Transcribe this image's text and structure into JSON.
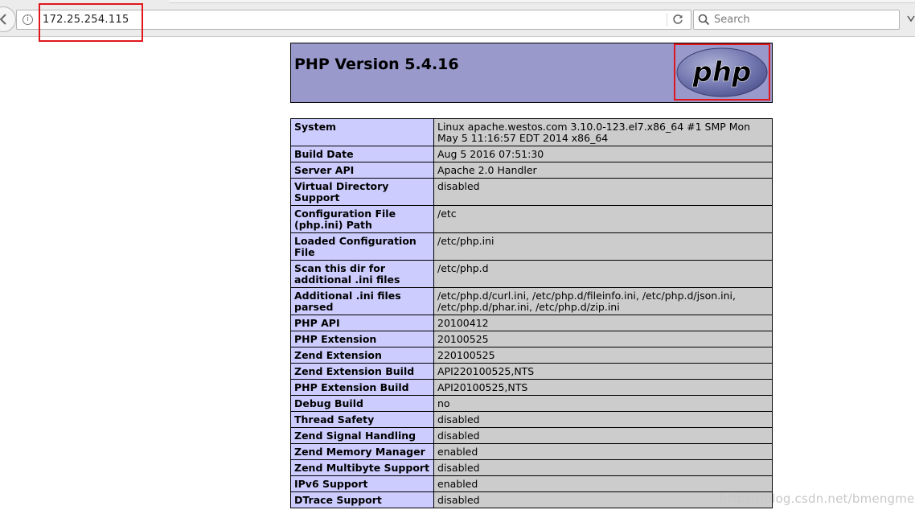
{
  "browser": {
    "url": "172.25.254.115",
    "search_placeholder": "Search",
    "icons": {
      "back": "back-arrow-icon",
      "info": "info-icon",
      "reload": "reload-icon",
      "search": "search-icon"
    }
  },
  "phpinfo": {
    "title": "PHP Version 5.4.16",
    "logo_text": "php",
    "colors": {
      "header_bg": "#9999cc",
      "key_bg": "#ccccff",
      "value_bg": "#cccccc",
      "highlight": "#e0161b"
    },
    "rows": [
      {
        "key": "System",
        "value": "Linux apache.westos.com 3.10.0-123.el7.x86_64 #1 SMP Mon May 5 11:16:57 EDT 2014 x86_64"
      },
      {
        "key": "Build Date",
        "value": "Aug 5 2016 07:51:30"
      },
      {
        "key": "Server API",
        "value": "Apache 2.0 Handler"
      },
      {
        "key": "Virtual Directory Support",
        "value": "disabled"
      },
      {
        "key": "Configuration File (php.ini) Path",
        "value": "/etc"
      },
      {
        "key": "Loaded Configuration File",
        "value": "/etc/php.ini"
      },
      {
        "key": "Scan this dir for additional .ini files",
        "value": "/etc/php.d"
      },
      {
        "key": "Additional .ini files parsed",
        "value": "/etc/php.d/curl.ini, /etc/php.d/fileinfo.ini, /etc/php.d/json.ini, /etc/php.d/phar.ini, /etc/php.d/zip.ini"
      },
      {
        "key": "PHP API",
        "value": "20100412"
      },
      {
        "key": "PHP Extension",
        "value": "20100525"
      },
      {
        "key": "Zend Extension",
        "value": "220100525"
      },
      {
        "key": "Zend Extension Build",
        "value": "API220100525,NTS"
      },
      {
        "key": "PHP Extension Build",
        "value": "API20100525,NTS"
      },
      {
        "key": "Debug Build",
        "value": "no"
      },
      {
        "key": "Thread Safety",
        "value": "disabled"
      },
      {
        "key": "Zend Signal Handling",
        "value": "disabled"
      },
      {
        "key": "Zend Memory Manager",
        "value": "enabled"
      },
      {
        "key": "Zend Multibyte Support",
        "value": "disabled"
      },
      {
        "key": "IPv6 Support",
        "value": "enabled"
      },
      {
        "key": "DTrace Support",
        "value": "disabled"
      }
    ]
  },
  "watermark": "https://blog.csdn.net/bmengmeng"
}
